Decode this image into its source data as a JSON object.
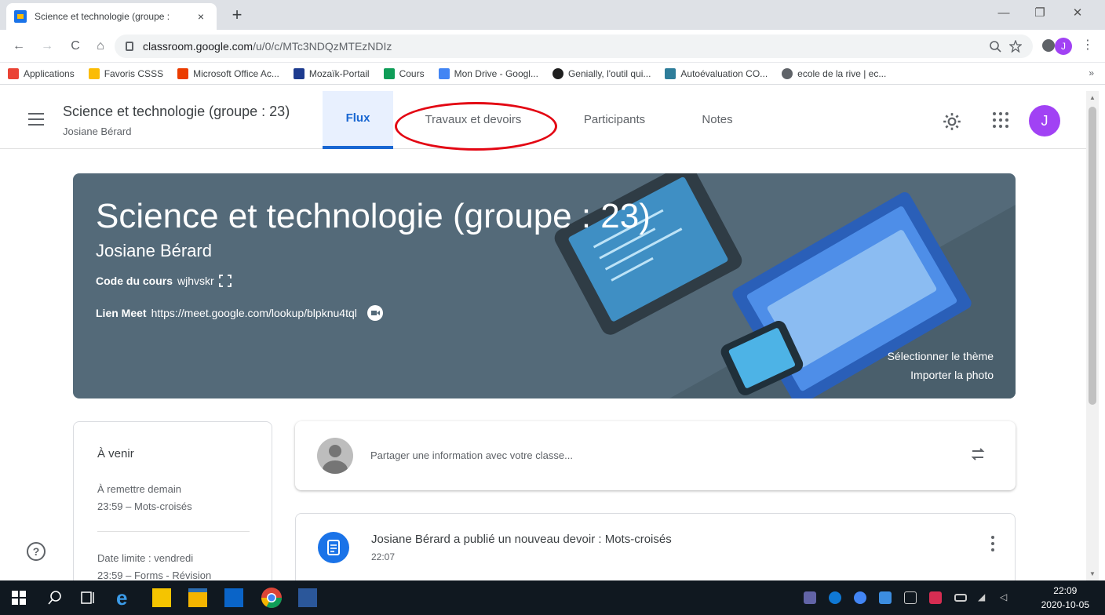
{
  "browser": {
    "tab_title": "Science et technologie (groupe :",
    "tab_close": "×",
    "new_tab": "+",
    "url_host": "classroom.google.com",
    "url_path": "/u/0/c/MTc3NDQzMTEzNDIz",
    "profile_initial": "J",
    "menu_dots": "⋮",
    "nav": {
      "back": "←",
      "forward": "→",
      "reload": "C",
      "home": "⌂"
    },
    "window": {
      "minimize": "—",
      "maximize": "❐",
      "close": "✕"
    }
  },
  "bookmarks": {
    "items": [
      {
        "label": "Applications",
        "color": "#ea4335"
      },
      {
        "label": "Favoris CSSS",
        "color": "#fbbc04"
      },
      {
        "label": "Microsoft Office Ac...",
        "color": "#eb3c00"
      },
      {
        "label": "Mozaïk-Portail",
        "color": "#1d3b8f"
      },
      {
        "label": "Cours",
        "color": "#0f9d58"
      },
      {
        "label": "Mon Drive - Googl...",
        "color": "#4285f4"
      },
      {
        "label": "Genially, l'outil qui...",
        "color": "#1f1f1f"
      },
      {
        "label": "Autoévaluation CO...",
        "color": "#2e7d9a"
      },
      {
        "label": "ecole de la rive | ec...",
        "color": "#5f6368"
      }
    ],
    "more": "»"
  },
  "header": {
    "class_title": "Science et technologie (groupe : 23)",
    "teacher": "Josiane Bérard",
    "tabs": [
      {
        "label": "Flux",
        "active": true
      },
      {
        "label": "Travaux et devoirs",
        "active": false
      },
      {
        "label": "Participants",
        "active": false
      },
      {
        "label": "Notes",
        "active": false
      }
    ],
    "avatar_initial": "J"
  },
  "banner": {
    "title": "Science et technologie (groupe : 23)",
    "teacher": "Josiane Bérard",
    "code_label": "Code du cours",
    "code_value": "wjhvskr",
    "meet_label": "Lien Meet",
    "meet_value": "https://meet.google.com/lookup/blpknu4tql",
    "select_theme": "Sélectionner le thème",
    "import_photo": "Importer la photo"
  },
  "upcoming": {
    "title": "À venir",
    "due_tomorrow": "À remettre demain",
    "item1": "23:59 – Mots-croisés",
    "due_friday": "Date limite : vendredi",
    "item2": "23:59 – Forms - Révision"
  },
  "share": {
    "placeholder": "Partager une information avec votre classe..."
  },
  "post": {
    "title": "Josiane Bérard a publié un nouveau devoir : Mots-croisés",
    "time": "22:07"
  },
  "help": "?",
  "taskbar": {
    "time": "22:09",
    "date": "2020-10-05"
  },
  "colors": {
    "accent": "#1967d2",
    "banner": "#546a79",
    "annotation": "#e30613",
    "avatar": "#a142f4"
  }
}
